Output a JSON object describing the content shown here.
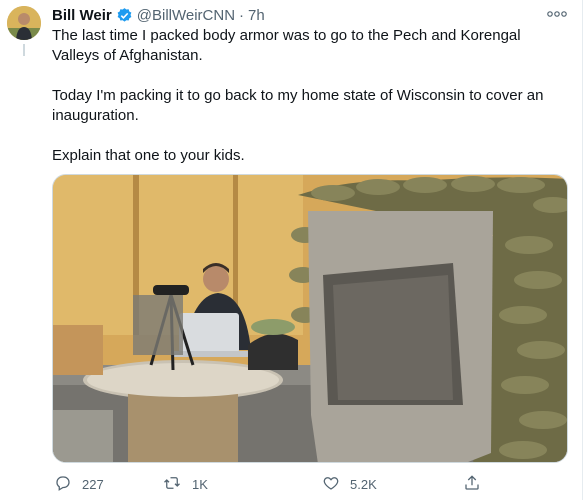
{
  "tweet": {
    "name": "Bill Weir",
    "handle": "@BillWeirCNN",
    "separator": "·",
    "time": "7h",
    "paragraphs": [
      "The last time I packed body armor was to go to the Pech and Korengal Valleys of Afghanistan.",
      "Today I'm packing it to go back to my home state of Wisconsin to cover an inauguration.",
      "Explain that one to your kids."
    ]
  },
  "actions": {
    "replies": "227",
    "retweets": "1K",
    "likes": "5.2K"
  },
  "icons": {
    "verified": "verified-badge-icon",
    "more": "more-options-icon",
    "reply": "reply-icon",
    "retweet": "retweet-icon",
    "like": "heart-icon",
    "share": "share-icon"
  },
  "colors": {
    "verified": "#1d9bf0",
    "secondary_text": "#536471"
  }
}
